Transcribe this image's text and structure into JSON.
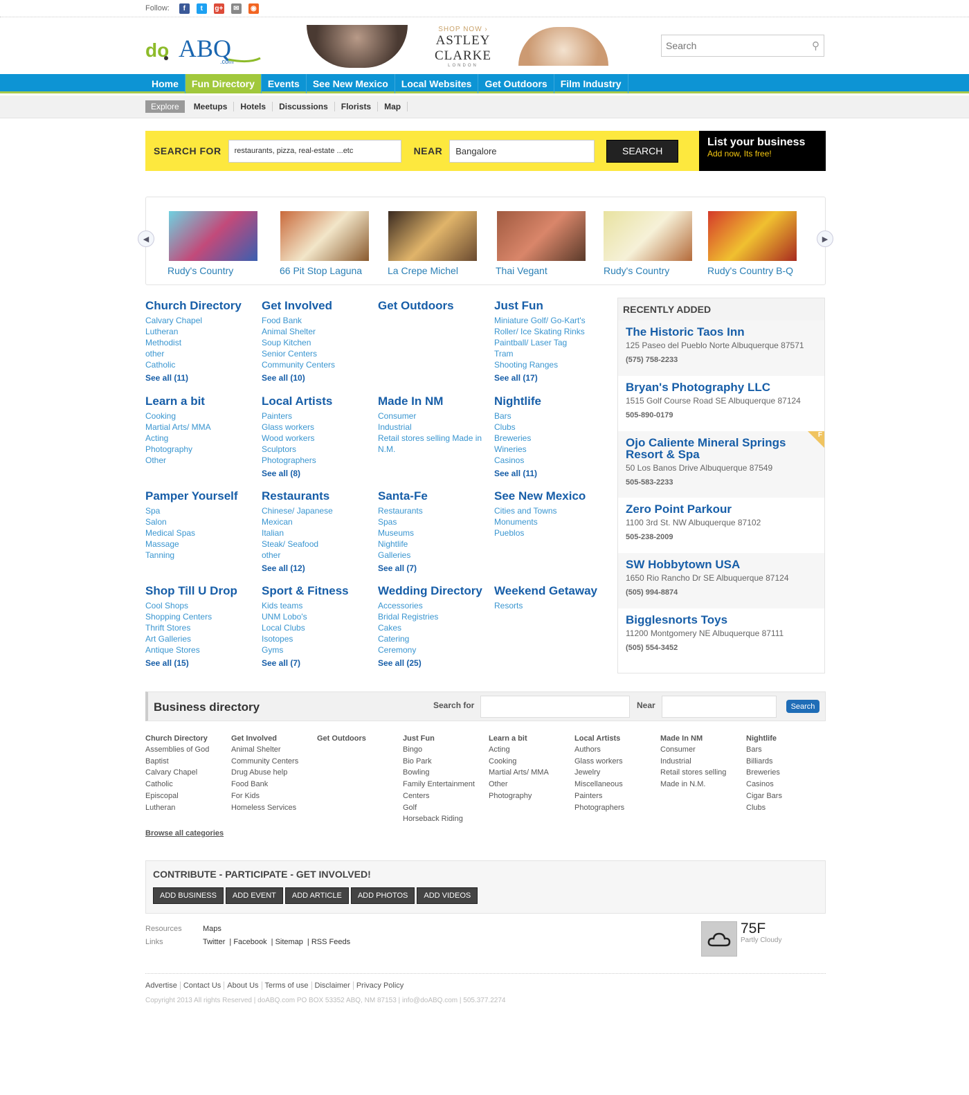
{
  "follow": {
    "label": "Follow:"
  },
  "logo": {
    "text_do": "do",
    "text_abq": "ABQ",
    "text_com": ".com"
  },
  "ad": {
    "shop": "SHOP NOW ›",
    "brand": "ASTLEY CLARKE",
    "city": "LONDON"
  },
  "search": {
    "placeholder": "Search"
  },
  "nav": [
    "Home",
    "Fun Directory",
    "Events",
    "See New Mexico",
    "Local Websites",
    "Get Outdoors",
    "Film Industry"
  ],
  "subnav": {
    "explore": "Explore",
    "items": [
      "Meetups",
      "Hotels",
      "Discussions",
      "Florists",
      "Map"
    ]
  },
  "searchbar": {
    "for_label": "SEARCH FOR",
    "for_placeholder": "restaurants, pizza, real-estate ...etc",
    "near_label": "NEAR",
    "near_value": "Bangalore",
    "button": "SEARCH",
    "list_title": "List your business",
    "list_sub": "Add now, Its free!"
  },
  "carousel": [
    "Rudy's Country",
    "66 Pit Stop Laguna",
    "La Crepe Michel",
    "Thai Vegant",
    "Rudy's Country",
    "Rudy's Country B-Q"
  ],
  "categories": [
    {
      "title": "Church Directory",
      "links": [
        "Calvary Chapel",
        "Lutheran",
        "Methodist",
        "other",
        "Catholic"
      ],
      "see": "See all (11)"
    },
    {
      "title": "Get Involved",
      "links": [
        "Food Bank",
        "Animal Shelter",
        "Soup Kitchen",
        "Senior Centers",
        "Community Centers"
      ],
      "see": "See all (10)"
    },
    {
      "title": "Get Outdoors",
      "links": [],
      "see": ""
    },
    {
      "title": "Just Fun",
      "links": [
        "Miniature Golf/ Go-Kart's",
        "Roller/ Ice Skating Rinks",
        "Paintball/ Laser Tag",
        "Tram",
        "Shooting Ranges"
      ],
      "see": "See all (17)"
    },
    {
      "title": "Learn a bit",
      "links": [
        "Cooking",
        "Martial Arts/ MMA",
        "Acting",
        "Photography",
        "Other"
      ],
      "see": ""
    },
    {
      "title": "Local Artists",
      "links": [
        "Painters",
        "Glass workers",
        "Wood workers",
        "Sculptors",
        "Photographers"
      ],
      "see": "See all (8)"
    },
    {
      "title": "Made In NM",
      "links": [
        "Consumer",
        "Industrial",
        "Retail stores selling Made in N.M."
      ],
      "see": ""
    },
    {
      "title": "Nightlife",
      "links": [
        "Bars",
        "Clubs",
        "Breweries",
        "Wineries",
        "Casinos"
      ],
      "see": "See all (11)"
    },
    {
      "title": "Pamper Yourself",
      "links": [
        "Spa",
        "Salon",
        "Medical Spas",
        "Massage",
        "Tanning"
      ],
      "see": ""
    },
    {
      "title": "Restaurants",
      "links": [
        "Chinese/ Japanese",
        "Mexican",
        "Italian",
        "Steak/ Seafood",
        "other"
      ],
      "see": "See all (12)"
    },
    {
      "title": "Santa-Fe",
      "links": [
        "Restaurants",
        "Spas",
        "Museums",
        "Nightlife",
        "Galleries"
      ],
      "see": "See all (7)"
    },
    {
      "title": "See New Mexico",
      "links": [
        "Cities and Towns",
        "Monuments",
        "Pueblos"
      ],
      "see": ""
    },
    {
      "title": "Shop Till U Drop",
      "links": [
        "Cool Shops",
        "Shopping Centers",
        "Thrift Stores",
        "Art Galleries",
        "Antique Stores"
      ],
      "see": "See all (15)"
    },
    {
      "title": "Sport & Fitness",
      "links": [
        "Kids teams",
        "UNM Lobo's",
        "Local Clubs",
        "Isotopes",
        "Gyms"
      ],
      "see": "See all (7)"
    },
    {
      "title": "Wedding Directory",
      "links": [
        "Accessories",
        "Bridal Registries",
        "Cakes",
        "Catering",
        "Ceremony"
      ],
      "see": "See all (25)"
    },
    {
      "title": "Weekend Getaway",
      "links": [
        "Resorts"
      ],
      "see": ""
    }
  ],
  "recent": {
    "title": "RECENTLY ADDED",
    "items": [
      {
        "name": "The Historic Taos Inn",
        "addr": "125 Paseo del Pueblo Norte Albuquerque 87571",
        "phone": "(575) 758-2233"
      },
      {
        "name": "Bryan's Photography LLC",
        "addr": "1515 Golf Course Road SE Albuquerque 87124",
        "phone": "505-890-0179"
      },
      {
        "name": "Ojo Caliente Mineral Springs Resort & Spa",
        "addr": "50 Los Banos Drive Albuquerque 87549",
        "phone": "505-583-2233",
        "badge": "F"
      },
      {
        "name": "Zero Point Parkour",
        "addr": "1100 3rd St. NW Albuquerque 87102",
        "phone": "505-238-2009"
      },
      {
        "name": "SW Hobbytown USA",
        "addr": "1650 Rio Rancho Dr SE Albuquerque 87124",
        "phone": "(505) 994-8874"
      },
      {
        "name": "Bigglesnorts Toys",
        "addr": "11200 Montgomery NE Albuquerque 87111",
        "phone": "(505) 554-3452"
      }
    ]
  },
  "bizdir": {
    "title": "Business directory",
    "search_for": "Search for",
    "near": "Near",
    "button": "Search",
    "columns": [
      {
        "h": "Church Directory",
        "l": [
          "Assemblies of God",
          "Baptist",
          "Calvary Chapel",
          "Catholic",
          "Episcopal",
          "Lutheran"
        ]
      },
      {
        "h": "Get Involved",
        "l": [
          "Animal Shelter",
          "Community Centers",
          "Drug Abuse help",
          "Food Bank",
          "For Kids",
          "Homeless Services"
        ]
      },
      {
        "h": "Get Outdoors",
        "l": []
      },
      {
        "h": "Just Fun",
        "l": [
          "Bingo",
          "Bio Park",
          "Bowling",
          "Family Entertainment",
          "Centers",
          "Golf",
          "Horseback Riding"
        ]
      },
      {
        "h": "Learn a bit",
        "l": [
          "Acting",
          "Cooking",
          "Martial Arts/ MMA",
          "Other",
          "Photography"
        ]
      },
      {
        "h": "Local Artists",
        "l": [
          "Authors",
          "Glass workers",
          "Jewelry",
          "Miscellaneous",
          "Painters",
          "Photographers"
        ]
      },
      {
        "h": "Made In NM",
        "l": [
          "Consumer",
          "Industrial",
          "Retail stores selling",
          "Made in N.M."
        ]
      },
      {
        "h": "Nightlife",
        "l": [
          "Bars",
          "Billiards",
          "Breweries",
          "Casinos",
          "Cigar Bars",
          "Clubs"
        ]
      }
    ],
    "browse": "Browse all categories"
  },
  "contribute": {
    "title": "CONTRIBUTE - PARTICIPATE - GET INVOLVED!",
    "buttons": [
      "ADD BUSINESS",
      "ADD EVENT",
      "ADD ARTICLE",
      "ADD PHOTOS",
      "ADD VIDEOS"
    ]
  },
  "resources": {
    "label1": "Resources",
    "label2": "Links",
    "maps": "Maps",
    "links": [
      "Twitter",
      "Facebook",
      "Sitemap",
      "RSS Feeds"
    ]
  },
  "weather": {
    "temp": "75F",
    "cond": "Partly Cloudy"
  },
  "footer": {
    "links": [
      "Advertise",
      "Contact Us",
      "About Us",
      "Terms of use",
      "Disclaimer",
      "Privacy Policy"
    ],
    "copy": "Copyright 2013 All rights Reserved | doABQ.com PO BOX 53352 ABQ, NM 87153 | info@doABQ.com | 505.377.2274"
  },
  "colors": {
    "nav": "#0d94d4",
    "nav_active": "#a1c83c",
    "searchbar": "#fde83e",
    "link": "#175ea8"
  }
}
